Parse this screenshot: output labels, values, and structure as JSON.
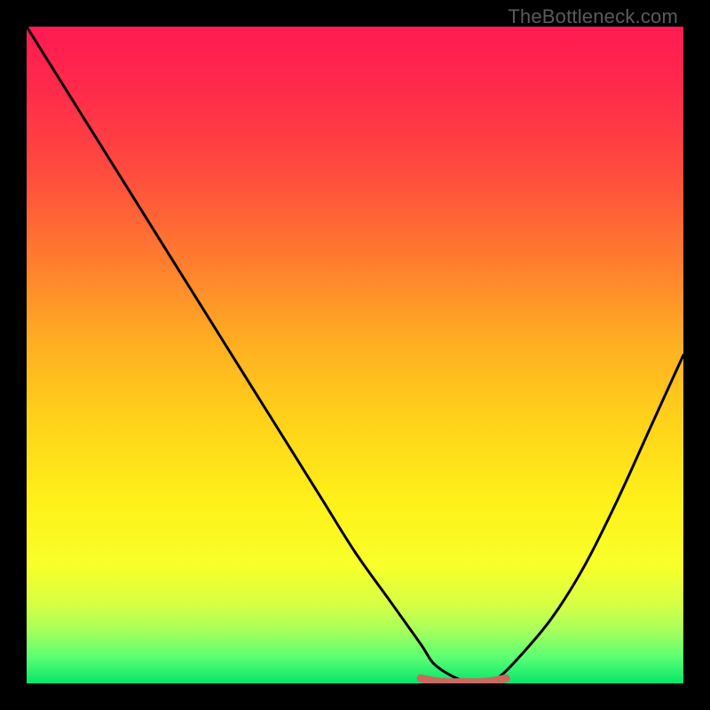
{
  "watermark": "TheBottleneck.com",
  "colors": {
    "frame": "#000000",
    "curve": "#000000",
    "highlight": "#c96a5f",
    "gradient_stops": [
      {
        "offset": 0.0,
        "color": "#ff1a52"
      },
      {
        "offset": 0.1,
        "color": "#ff2b4a"
      },
      {
        "offset": 0.22,
        "color": "#ff4b3e"
      },
      {
        "offset": 0.35,
        "color": "#ff7a2f"
      },
      {
        "offset": 0.48,
        "color": "#ffae22"
      },
      {
        "offset": 0.6,
        "color": "#ffd21a"
      },
      {
        "offset": 0.72,
        "color": "#fff019"
      },
      {
        "offset": 0.82,
        "color": "#f8ff2a"
      },
      {
        "offset": 0.88,
        "color": "#d6ff44"
      },
      {
        "offset": 0.92,
        "color": "#a6ff5c"
      },
      {
        "offset": 0.96,
        "color": "#5bff73"
      },
      {
        "offset": 1.0,
        "color": "#05e66a"
      }
    ]
  },
  "chart_data": {
    "type": "line",
    "title": "",
    "xlabel": "",
    "ylabel": "",
    "xlim": [
      0,
      100
    ],
    "ylim": [
      0,
      100
    ],
    "note": "Bottleneck-style V-curve. y is relative magnitude (0 = no bottleneck at trough). x is relative position across the horizontal axis. Values estimated from pixels.",
    "series": [
      {
        "name": "curve",
        "x": [
          0,
          5,
          10,
          15,
          20,
          25,
          30,
          35,
          40,
          45,
          50,
          55,
          60,
          62,
          65,
          68,
          70,
          72,
          75,
          80,
          85,
          90,
          95,
          100
        ],
        "values": [
          100,
          92,
          84,
          76,
          68,
          60,
          52,
          44,
          36,
          28,
          20,
          13,
          6,
          3,
          1,
          0,
          0,
          1,
          4,
          10,
          18,
          28,
          39,
          50
        ]
      }
    ],
    "highlight": {
      "x_start": 60,
      "x_end": 73,
      "y": 0.5,
      "description": "flat trough segment drawn in red"
    }
  }
}
